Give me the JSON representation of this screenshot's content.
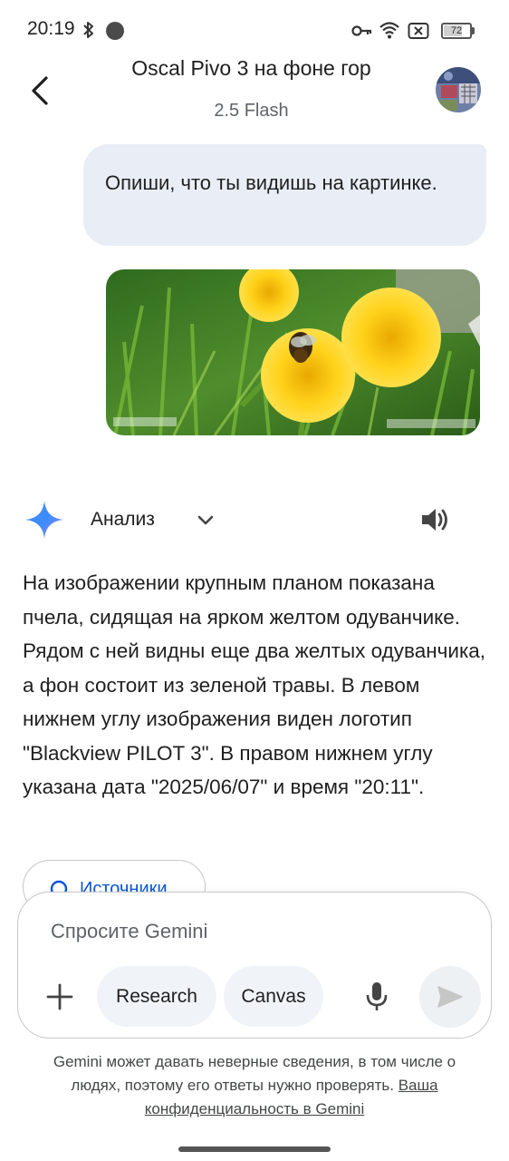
{
  "status_bar": {
    "time": "20:19",
    "battery": "72",
    "battery_level": 0.72,
    "icons": [
      "bluetooth-icon",
      "notification-dot-icon",
      "vpn-key-icon",
      "wifi-icon",
      "no-sim-icon",
      "battery-icon"
    ]
  },
  "header": {
    "title": "Oscal Pivo 3 на фоне гор",
    "model": "2.5 Flash",
    "back_icon": "back-arrow-icon",
    "avatar_icon": "user-avatar"
  },
  "user_message": {
    "text": "Опиши, что ты видишь на картинке."
  },
  "response": {
    "mode_label": "Анализ",
    "text": "На изображении крупным планом показана пчела, сидящая на ярком желтом одуванчике. Рядом с ней видны еще два желтых одуванчика, а фон состоит из зеленой травы. В левом нижнем углу изображения виден логотип \"Blackview PILOT 3\". В правом нижнем углу указана дата \"2025/06/07\" и время \"20:11\".",
    "sources_label": "Источники"
  },
  "composer": {
    "placeholder": "Спросите Gemini",
    "research_label": "Research",
    "canvas_label": "Canvas"
  },
  "footer": {
    "disclaimer": "Gemini может давать неверные сведения, в том числе о людях, поэтому его ответы нужно проверять.",
    "privacy_link": "Ваша конфиденциальность в Gemini"
  },
  "colors": {
    "user_bubble": "#e9eef6",
    "chip_bg": "#f0f4f9",
    "link_blue": "#0b57d0",
    "text_primary": "#1f1f1f",
    "text_secondary": "#5f6368"
  }
}
